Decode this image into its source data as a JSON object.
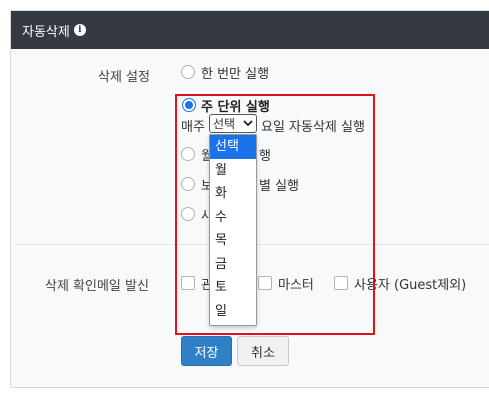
{
  "header": {
    "title": "자동삭제",
    "info_icon": "i"
  },
  "delete_setting": {
    "label": "삭제 설정",
    "options": [
      {
        "label": "한 번만 실행",
        "checked": false
      },
      {
        "label": "주 단위 실행",
        "checked": true
      },
      {
        "label": "월",
        "suffix": "행",
        "checked": false
      },
      {
        "label": "보",
        "suffix": "별 실행",
        "checked": false
      },
      {
        "label": "사",
        "checked": false
      }
    ],
    "weekly_prefix": "매주",
    "weekly_suffix": "요일 자동삭제 실행",
    "day_select": {
      "value": "선택",
      "options": [
        "선택",
        "월",
        "화",
        "수",
        "목",
        "금",
        "토",
        "일"
      ],
      "highlighted_index": 0
    }
  },
  "email": {
    "label": "삭제 확인메일 발신",
    "options": [
      {
        "label": "관",
        "checked": false
      },
      {
        "label": "마스터",
        "checked": false
      },
      {
        "label": "사용자 (Guest제외)",
        "checked": false
      }
    ]
  },
  "buttons": {
    "save": "저장",
    "cancel": "취소"
  },
  "colors": {
    "header_bg": "#343a40",
    "accent": "#1a73e8",
    "save_bg": "#2f80c7",
    "highlight_border": "#e3101c"
  }
}
